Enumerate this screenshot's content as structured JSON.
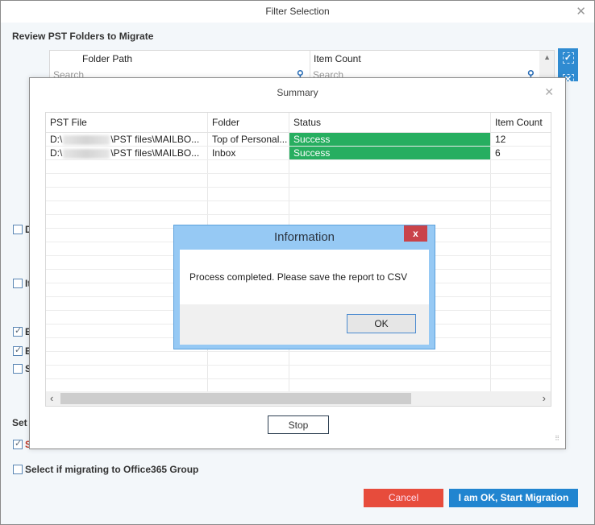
{
  "filter_window": {
    "title": "Filter Selection",
    "close_icon": "close-icon",
    "section_heading": "Review PST Folders to Migrate",
    "folder_grid": {
      "columns": [
        "Folder Path",
        "Item Count"
      ],
      "search_placeholders": [
        "Search",
        "Search"
      ],
      "search_icon": "search-icon",
      "scroll_up_icon": "triangle-up-icon"
    },
    "side_buttons": {
      "select_all": "✓",
      "deselect_all": "✕"
    },
    "checkboxes": [
      {
        "label": "D",
        "checked": false
      },
      {
        "label": "It",
        "checked": false
      },
      {
        "label": "E",
        "checked": true
      },
      {
        "label": "E",
        "checked": true
      },
      {
        "label": "S",
        "checked": false
      }
    ],
    "set_label": "Set o",
    "set_checkbox": {
      "label": "S",
      "checked": true
    },
    "office365_checkbox": {
      "label": "Select if migrating to Office365 Group",
      "checked": false
    },
    "cancel_label": "Cancel",
    "start_label": "I am OK, Start Migration",
    "colors": {
      "cancel": "#e74c3c",
      "start": "#2185d0"
    }
  },
  "summary_dialog": {
    "title": "Summary",
    "columns": [
      "PST File",
      "Folder",
      "Status",
      "Item Count"
    ],
    "rows": [
      {
        "pst_prefix": "D:\\",
        "pst_suffix": "\\PST files\\MAILBO...",
        "folder": "Top of Personal...",
        "status": "Success",
        "item_count": "12"
      },
      {
        "pst_prefix": "D:\\",
        "pst_suffix": "\\PST files\\MAILBO...",
        "folder": "Inbox",
        "status": "Success",
        "item_count": "6"
      }
    ],
    "status_color": "#27ae60",
    "stop_label": "Stop",
    "scroll_left": "‹",
    "scroll_right": "›"
  },
  "info_dialog": {
    "title": "Information",
    "close_label": "x",
    "message": "Process completed. Please save the report to CSV",
    "ok_label": "OK"
  }
}
